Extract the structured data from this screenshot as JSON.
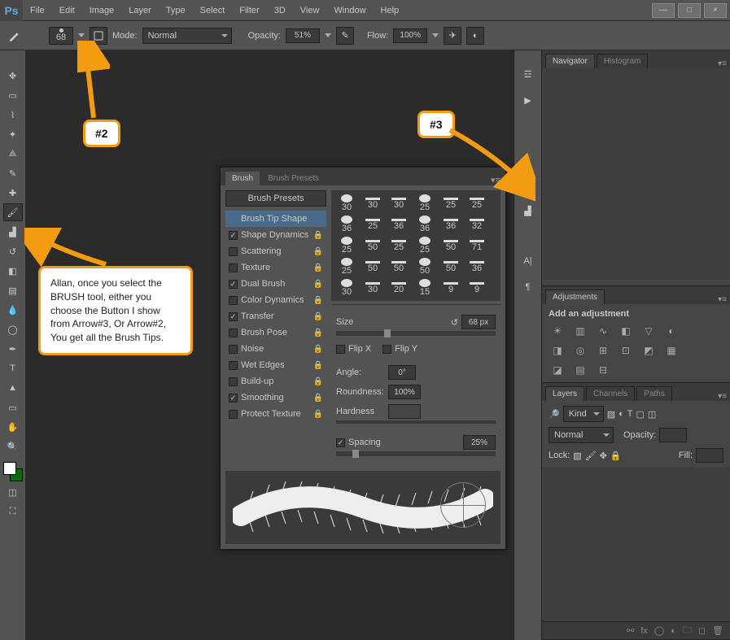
{
  "app_logo": "Ps",
  "menu": [
    "File",
    "Edit",
    "Image",
    "Layer",
    "Type",
    "Select",
    "Filter",
    "3D",
    "View",
    "Window",
    "Help"
  ],
  "options_bar": {
    "brush_size": "68",
    "mode_label": "Mode:",
    "mode_value": "Normal",
    "opacity_label": "Opacity:",
    "opacity_value": "51%",
    "flow_label": "Flow:",
    "flow_value": "100%"
  },
  "annotations": {
    "tag2": "#2",
    "tag3": "#3",
    "callout": "Allan, once you select the BRUSH tool, either you choose the Button I show from Arrow#3, Or Arrow#2, You get all the Brush Tips."
  },
  "brush_panel": {
    "tab_brush": "Brush",
    "tab_presets": "Brush Presets",
    "presets_btn": "Brush Presets",
    "options": [
      {
        "label": "Brush Tip Shape",
        "checked": null,
        "selected": true
      },
      {
        "label": "Shape Dynamics",
        "checked": true
      },
      {
        "label": "Scattering",
        "checked": false
      },
      {
        "label": "Texture",
        "checked": false
      },
      {
        "label": "Dual Brush",
        "checked": true
      },
      {
        "label": "Color Dynamics",
        "checked": false
      },
      {
        "label": "Transfer",
        "checked": true
      },
      {
        "label": "Brush Pose",
        "checked": false
      },
      {
        "label": "Noise",
        "checked": false
      },
      {
        "label": "Wet Edges",
        "checked": false
      },
      {
        "label": "Build-up",
        "checked": false
      },
      {
        "label": "Smoothing",
        "checked": true
      },
      {
        "label": "Protect Texture",
        "checked": false
      }
    ],
    "tips": [
      30,
      30,
      30,
      25,
      25,
      25,
      36,
      25,
      36,
      36,
      36,
      32,
      25,
      50,
      25,
      25,
      50,
      71,
      25,
      50,
      50,
      50,
      50,
      36,
      30,
      30,
      20,
      15,
      9,
      9
    ],
    "size_label": "Size",
    "size_value": "68 px",
    "flipx": "Flip X",
    "flipy": "Flip Y",
    "angle_label": "Angle:",
    "angle_value": "0°",
    "roundness_label": "Roundness:",
    "roundness_value": "100%",
    "hardness_label": "Hardness",
    "spacing_label": "Spacing",
    "spacing_value": "25%"
  },
  "navigator": {
    "tab1": "Navigator",
    "tab2": "Histogram"
  },
  "adjustments": {
    "title": "Adjustments",
    "subtitle": "Add an adjustment"
  },
  "layers": {
    "tab1": "Layers",
    "tab2": "Channels",
    "tab3": "Paths",
    "kind": "Kind",
    "blend": "Normal",
    "opacity_label": "Opacity:",
    "lock_label": "Lock:",
    "fill_label": "Fill:"
  }
}
